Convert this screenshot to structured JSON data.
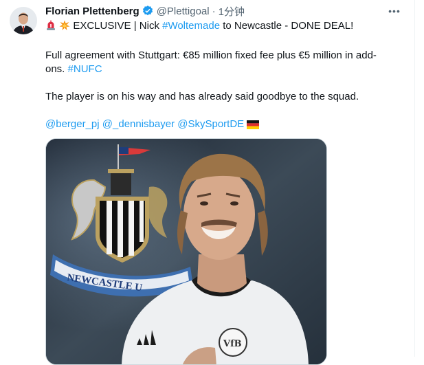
{
  "author": {
    "name": "Florian Plettenberg",
    "handle": "@Plettigoal",
    "separator": "·",
    "time": "1分钟"
  },
  "more_label": "•••",
  "tweet": {
    "headline_prefix": "EXCLUSIVE | Nick ",
    "hashtag_player": "#Woltemade",
    "headline_suffix": " to Newcastle - DONE DEAL!",
    "p2_line1": "Full agreement with Stuttgart: €85 million fixed fee plus €5 million in add-",
    "p2_line2_prefix": "ons. ",
    "hashtag_club": "#NUFC",
    "p3": "The player is on his way and has already said goodbye to the squad.",
    "mention1": "@berger_pj",
    "mention2": "@_dennisbayer",
    "mention3": "@SkySportDE"
  },
  "icons": {
    "verified": "verified-badge-icon",
    "siren": "siren-emoji-icon",
    "explosion": "collision-emoji-icon",
    "flag": "germany-flag-emoji-icon",
    "more": "more-options-icon"
  },
  "image": {
    "crest_text": "NEWCASTLE U",
    "badge_text": "VfB"
  },
  "colors": {
    "link": "#1d9bf0",
    "text": "#0f1419",
    "muted": "#536471"
  }
}
